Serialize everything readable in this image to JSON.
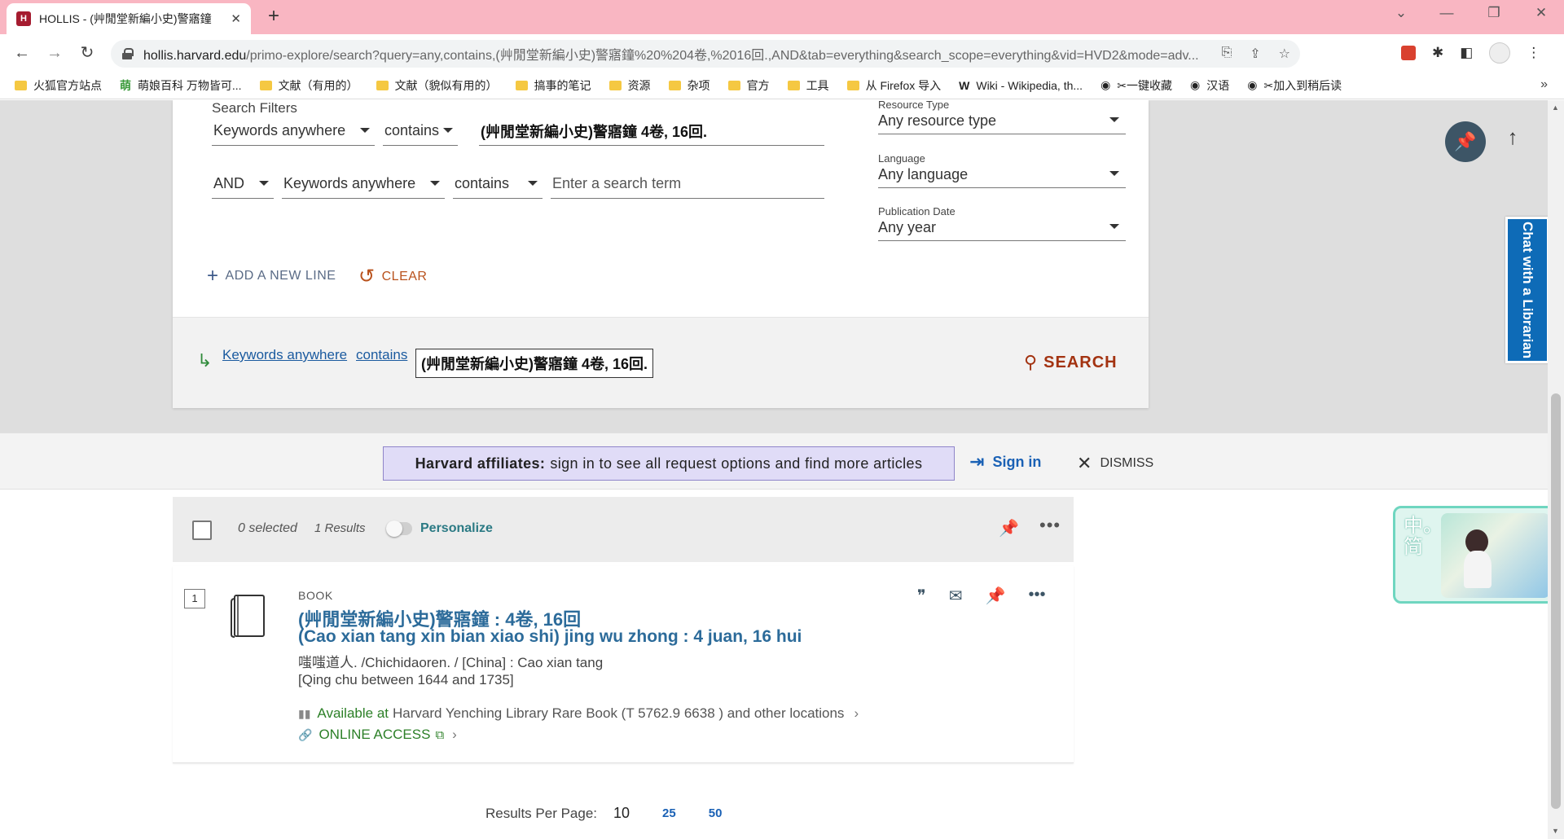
{
  "browser": {
    "tab": {
      "favicon": "H",
      "title": "HOLLIS - (艸閒堂新編小史)警寤鐘"
    },
    "url_host": "hollis.harvard.edu",
    "url_path": "/primo-explore/search?query=any,contains,(艸閒堂新編小史)警寤鐘%20%204卷,%2016回.,AND&tab=everything&search_scope=everything&vid=HVD2&mode=adv...",
    "bookmarks": [
      "火狐官方站点",
      "萌娘百科 万物皆可...",
      "文献（有用的）",
      "文献（貌似有用的）",
      "搞事的笔记",
      "资源",
      "杂项",
      "官方",
      "工具",
      "从 Firefox 导入",
      "Wiki - Wikipedia, th...",
      "✂一键收藏",
      "汉语",
      "✂加入到稍后读"
    ],
    "bookmark_more": "»"
  },
  "search": {
    "filters_title": "Search Filters",
    "row1": {
      "field": "Keywords anywhere",
      "op": "contains",
      "value": "(艸閒堂新編小史)警寤鐘  4卷, 16回."
    },
    "row2": {
      "bool": "AND",
      "field": "Keywords anywhere",
      "op": "contains",
      "placeholder": "Enter a search term"
    },
    "resource_type": {
      "label": "Resource Type",
      "value": "Any resource type"
    },
    "language": {
      "label": "Language",
      "value": "Any language"
    },
    "pub_date": {
      "label": "Publication Date",
      "value": "Any year"
    },
    "add_line": "ADD A NEW LINE",
    "clear": "CLEAR",
    "summary": {
      "field": "Keywords anywhere",
      "op": "contains",
      "query": "(艸閒堂新編小史)警寤鐘  4卷, 16回."
    },
    "search_button": "SEARCH"
  },
  "chat_tab": "Chat with a Librarian",
  "banner": {
    "bold": "Harvard affiliates:",
    "text": "sign in to see all request options and find more articles",
    "signin": "Sign in",
    "dismiss": "DISMISS"
  },
  "results_bar": {
    "selected": "0 selected",
    "count": "1 Results",
    "personalize": "Personalize"
  },
  "result": {
    "number": "1",
    "type": "BOOK",
    "title": "(艸閒堂新編小史)警寤鐘 : 4卷, 16回",
    "romanized": "(Cao xian tang xin bian xiao shi) jing wu zhong : 4 juan, 16 hui",
    "author": "嗤嗤道人. /Chichidaoren. / [China] : Cao xian tang",
    "date": "[Qing chu between 1644 and 1735]",
    "available_label": "Available at",
    "available_loc": "Harvard Yenching Library  Rare Book (T 5762.9 6638 ) and other locations",
    "online": "ONLINE ACCESS"
  },
  "per_page": {
    "label": "Results Per Page:",
    "options": [
      "10",
      "25",
      "50"
    ]
  },
  "widget": {
    "text": "中。简"
  },
  "colors": {
    "tabbar": "#f9b6c2",
    "accent_blue": "#1a61b5",
    "search_red": "#a33311",
    "chat_blue": "#0e6bb7"
  }
}
